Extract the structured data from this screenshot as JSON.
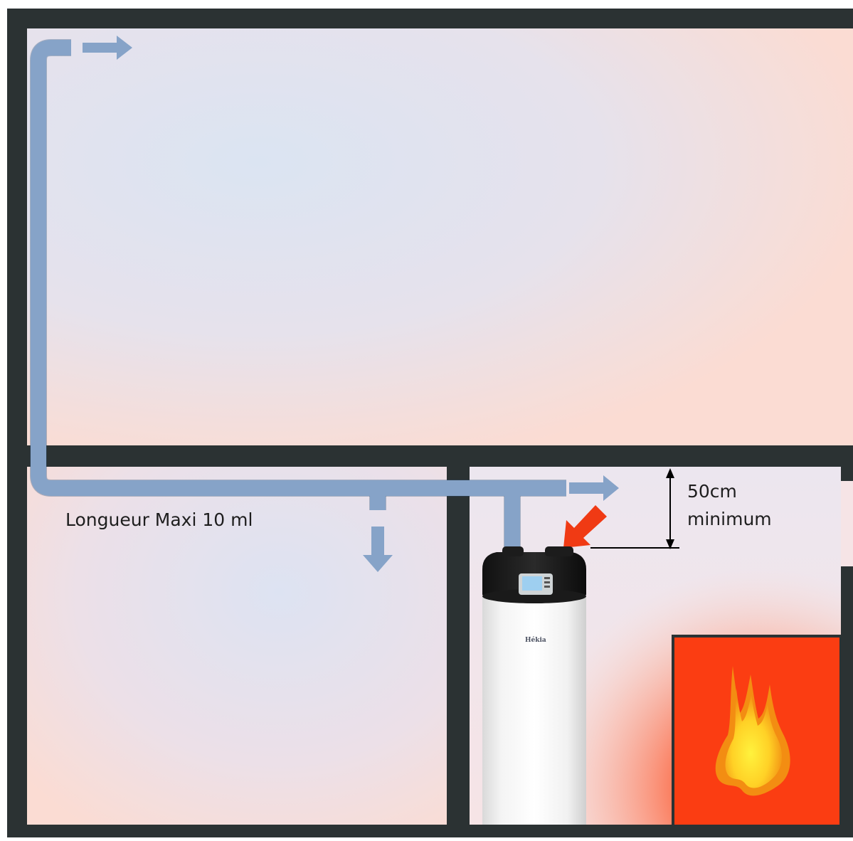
{
  "labels": {
    "duct_length": "Longueur Maxi 10 ml",
    "clearance_value": "50cm",
    "clearance_note": "minimum"
  },
  "device": {
    "brand": "Hékia"
  },
  "icons": {
    "airflow_arrow": "arrow-icon",
    "hot_air_arrow": "arrow-icon",
    "fire": "flame-icon",
    "dimension": "double-arrow-icon"
  },
  "colors": {
    "wall": "#2b3233",
    "duct": "#86a3c8",
    "room_warm": "#fbdcd3",
    "room_cool": "#dbe4f2",
    "heat_source": "#fb3d12",
    "hot_arrow": "#f03a14",
    "flame_outer": "#f59c13",
    "flame_inner": "#fff03c"
  }
}
